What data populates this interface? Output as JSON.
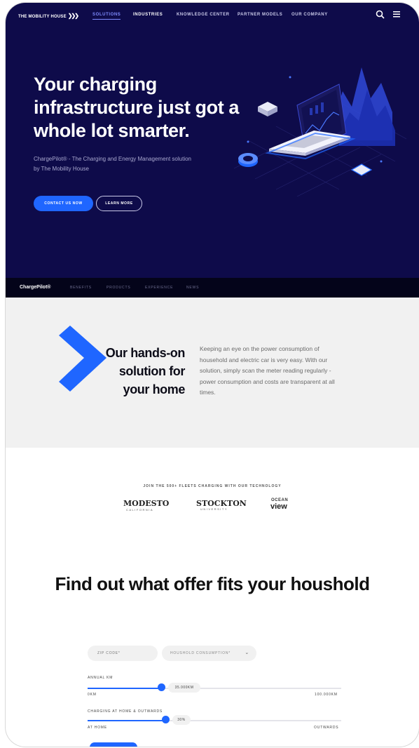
{
  "nav": {
    "logo": "THE MOBILITY HOUSE",
    "links": [
      "SOLUTIONS",
      "INDUSTRIES",
      "KNOWLEDGE CENTER",
      "PARTNER MODELS",
      "OUR COMPANY"
    ],
    "icons": [
      "search-icon",
      "menu-icon"
    ]
  },
  "hero": {
    "headline": "Your charging infrastructure just got a whole lot smarter.",
    "subtext": "ChargePilot® - The Charging and Energy Management solution by The Mobility House",
    "primary_button": "CONTACT US NOW",
    "secondary_button": "LEARN MORE",
    "colors": {
      "background": "#0e0b4a",
      "accent": "#1f66ff"
    }
  },
  "subnav": {
    "brand": "ChargePilot®",
    "items": [
      "BENEFITS",
      "PRODUCTS",
      "EXPERIENCE",
      "NEWS"
    ]
  },
  "home": {
    "title": "Our hands-on solution for your home",
    "description": "Keeping an eye on the power consumption of household and electric car is very easy. With our solution, simply scan the meter reading regularly - power consumption and costs are transparent at all times."
  },
  "fleets": {
    "label": "JOIN THE 500+ FLEETS CHARGING WITH OUR TECHNOLOGY",
    "logos": {
      "modesto": "MODESTO",
      "modesto_sub": "CALIFORNIA",
      "stockton": "STOCKTON",
      "stockton_sub": "UNIVERSITY",
      "ocean": "OCEAN",
      "view": "view"
    }
  },
  "offer": {
    "title": "Find out what offer fits your houshold",
    "zip_placeholder": "ZIP CODE*",
    "consumption_select": "HOUSHOLD CONSUMPTION*",
    "annual_km": {
      "label": "ANNUAL KM",
      "value": "35.000KM",
      "min_label": "0KM",
      "max_label": "100.000KM",
      "fraction": 0.35
    },
    "charging": {
      "label": "CHARGING AT HOME & OUTWARDS",
      "value": "30%",
      "min_label": "AT HOME",
      "max_label": "OUTWARDS",
      "fraction": 0.3
    }
  }
}
